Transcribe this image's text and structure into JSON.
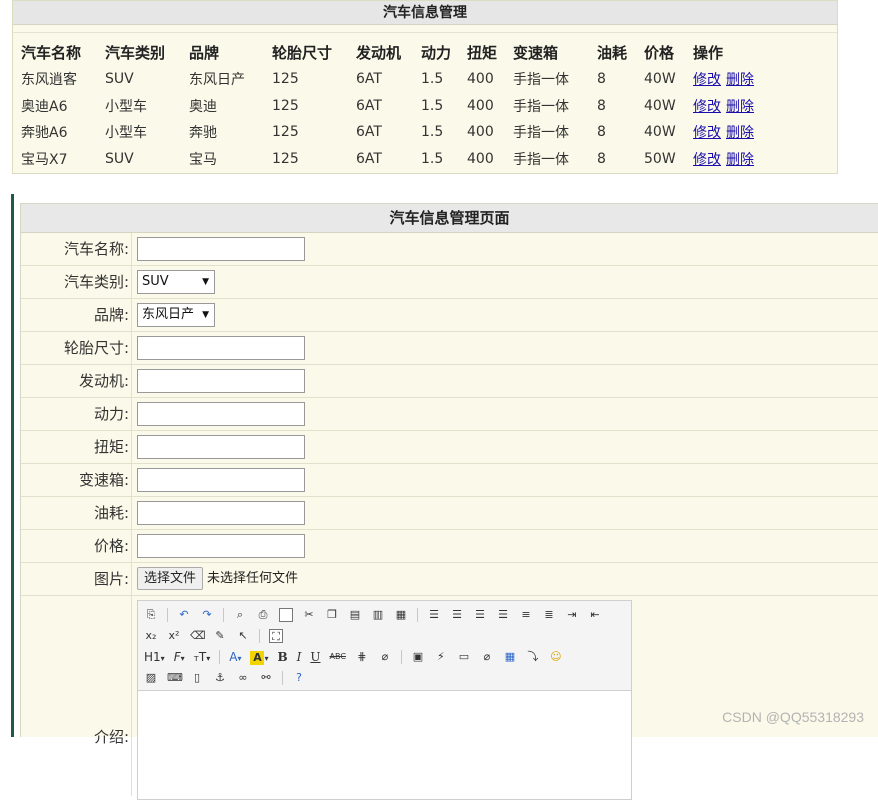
{
  "list": {
    "title": "汽车信息管理",
    "columns": [
      "汽车名称",
      "汽车类别",
      "品牌",
      "轮胎尺寸",
      "发动机",
      "动力",
      "扭矩",
      "变速箱",
      "油耗",
      "价格",
      "操作"
    ],
    "rows": [
      [
        "东风逍客",
        "SUV",
        "东风日产",
        "125",
        "6AT",
        "1.5",
        "400",
        "手指一体",
        "8",
        "40W"
      ],
      [
        "奥迪A6",
        "小型车",
        "奥迪",
        "125",
        "6AT",
        "1.5",
        "400",
        "手指一体",
        "8",
        "40W"
      ],
      [
        "奔驰A6",
        "小型车",
        "奔驰",
        "125",
        "6AT",
        "1.5",
        "400",
        "手指一体",
        "8",
        "40W"
      ],
      [
        "宝马X7",
        "SUV",
        "宝马",
        "125",
        "6AT",
        "1.5",
        "400",
        "手指一体",
        "8",
        "50W"
      ]
    ],
    "edit_label": "修改",
    "delete_label": "删除"
  },
  "form": {
    "title": "汽车信息管理页面",
    "labels": {
      "name": "汽车名称:",
      "category": "汽车类别:",
      "brand": "品牌:",
      "tire": "轮胎尺寸:",
      "engine": "发动机:",
      "power": "动力:",
      "torque": "扭矩:",
      "gearbox": "变速箱:",
      "fuel": "油耗:",
      "price": "价格:",
      "image": "图片:"
    },
    "category_selected": "SUV",
    "brand_selected": "东风日产",
    "file_button": "选择文件",
    "file_status": "未选择任何文件"
  },
  "toolbar": {
    "heading": "H1",
    "font_family": "F",
    "font_size": "T",
    "font_color": "A",
    "highlight": "A",
    "bold": "B",
    "italic": "I",
    "underline": "U",
    "strike": "ABC"
  },
  "watermark": "CSDN @QQ55318293",
  "colors": {
    "panel_bg": "#fbfaea",
    "header_bg": "#e6e6e6",
    "link": "#1a0dab",
    "side_bar": "#1e5c4a"
  }
}
